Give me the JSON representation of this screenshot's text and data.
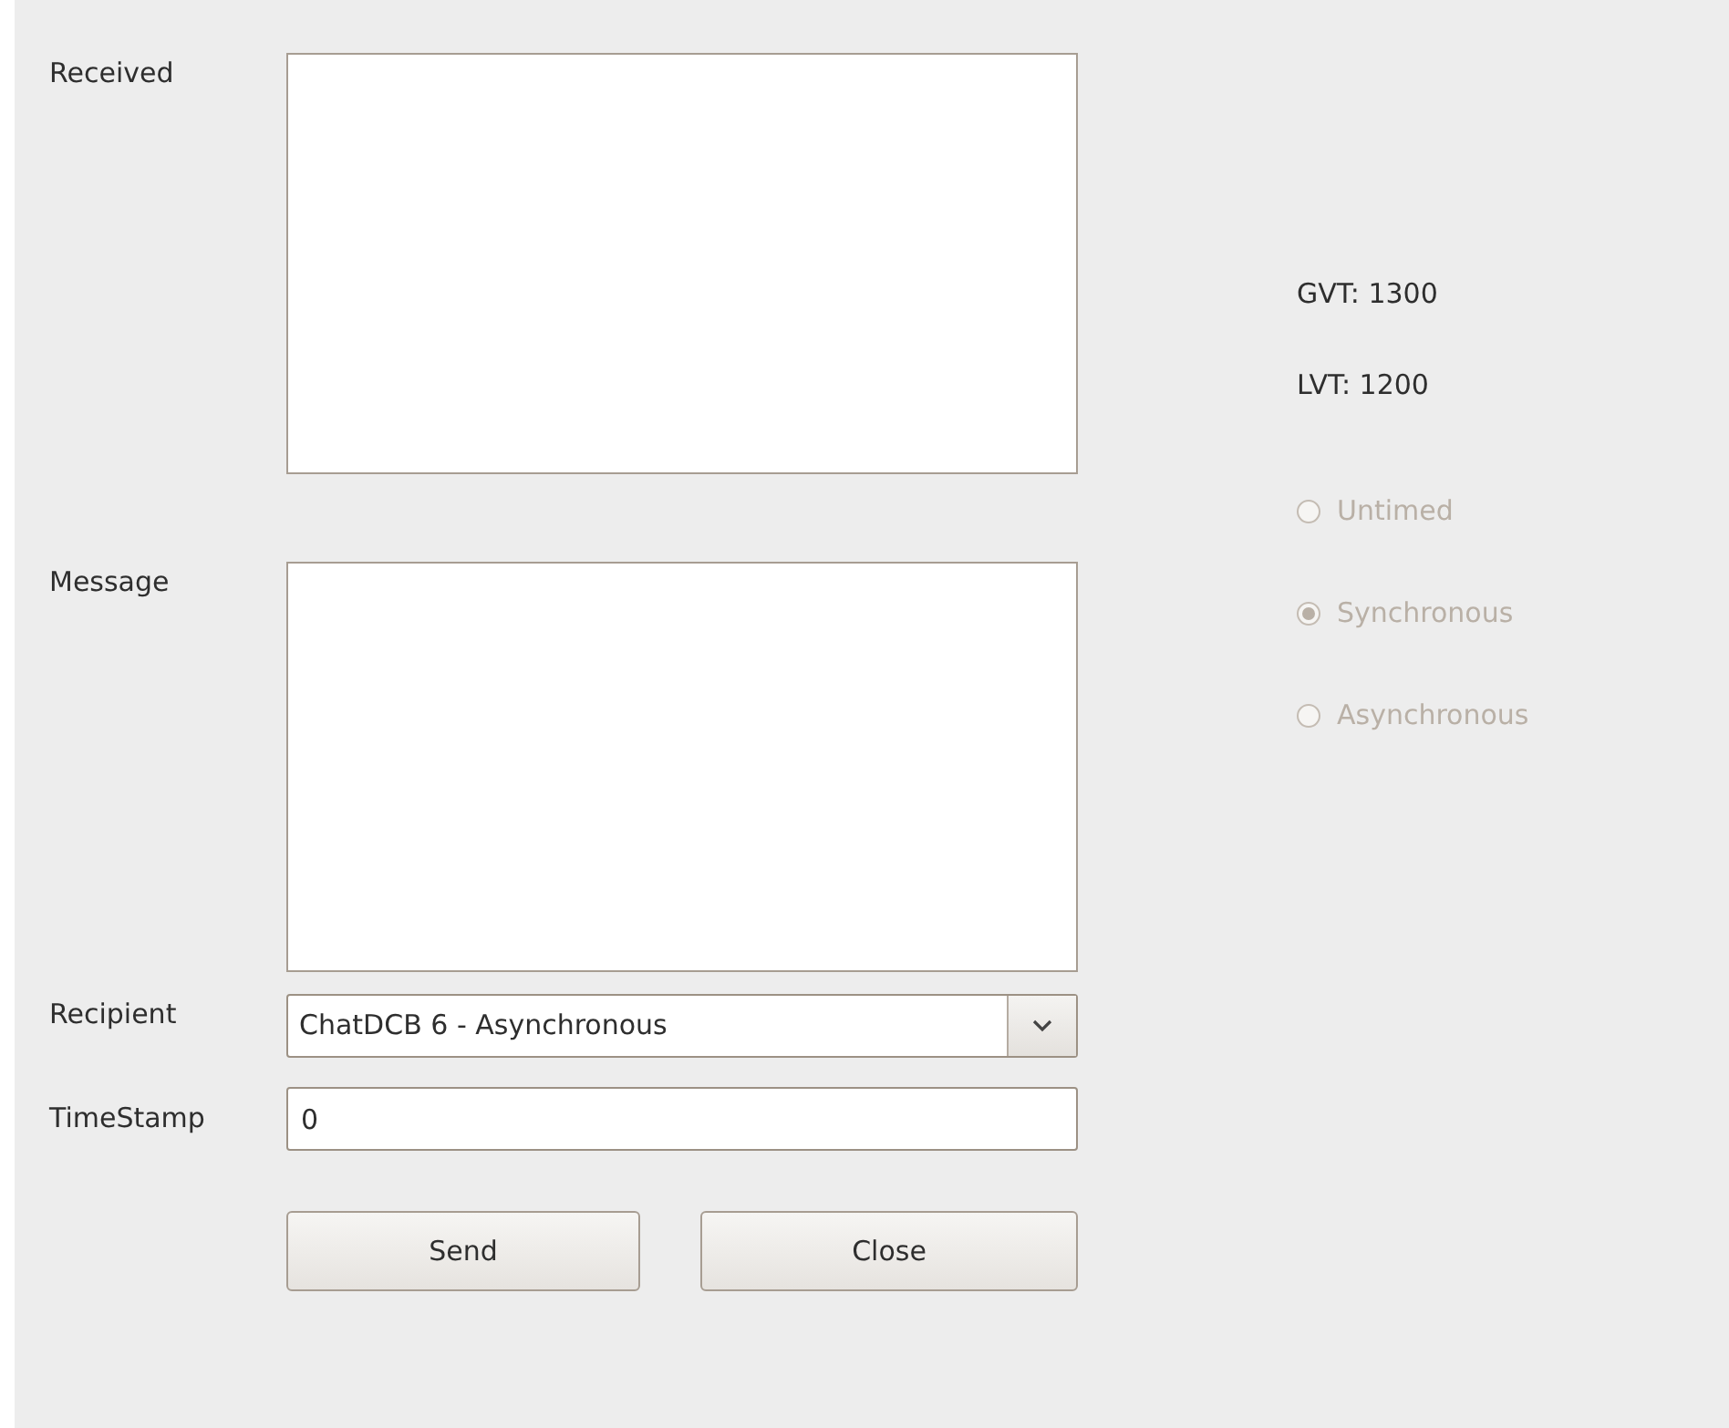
{
  "received": {
    "label": "Received"
  },
  "message": {
    "label": "Message"
  },
  "recipient": {
    "label": "Recipient",
    "value": "ChatDCB 6 - Asynchronous"
  },
  "timestamp": {
    "label": "TimeStamp",
    "value": "0"
  },
  "buttons": [
    "Send",
    "Close"
  ],
  "gvt": "GVT: 1300",
  "lvt": "LVT: 1200",
  "modes": [
    {
      "label": "Untimed",
      "selected": false,
      "disabled": true
    },
    {
      "label": "Synchronous",
      "selected": true,
      "disabled": true
    },
    {
      "label": "Asynchronous",
      "selected": false,
      "disabled": true
    }
  ]
}
